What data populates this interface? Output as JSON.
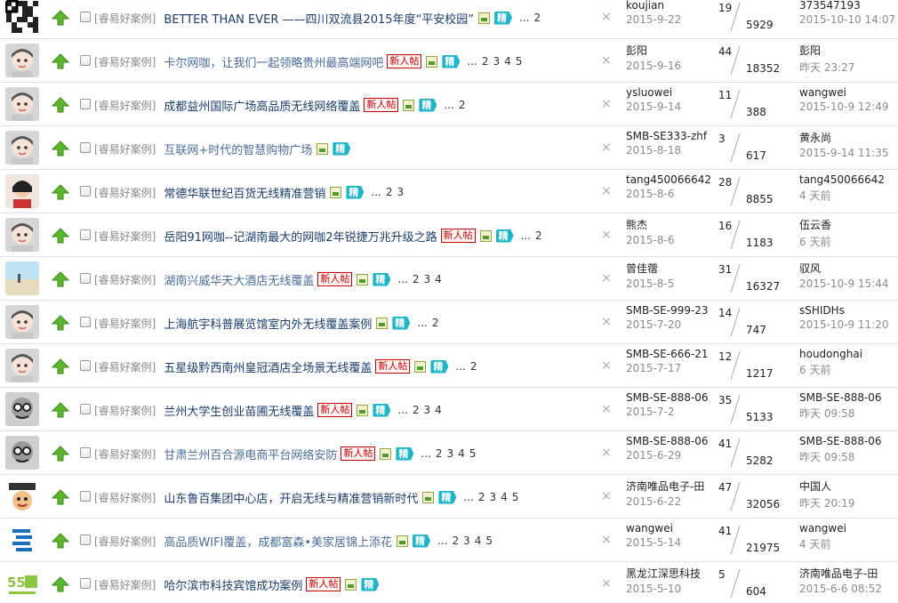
{
  "threads": [
    {
      "avatar": "qr",
      "tag": "[睿易好案例]",
      "title": "BETTER THAN EVER ——四川双流县2015年度“平安校园”",
      "dim": false,
      "new": false,
      "img": true,
      "jing": true,
      "pages": [
        "...",
        "2"
      ],
      "author": "koujian",
      "date": "2015-9-22",
      "replies": "19",
      "views": "5929",
      "last_user": "373547193",
      "last_time": "2015-10-10 14:07"
    },
    {
      "avatar": "face",
      "tag": "[睿易好案例]",
      "title": "卡尔网咖，让我们一起领略贵州最高端网吧",
      "dim": true,
      "new": true,
      "img": true,
      "jing": true,
      "pages": [
        "...",
        "2",
        "3",
        "4",
        "5"
      ],
      "author": "彭阳",
      "date": "2015-9-16",
      "replies": "44",
      "views": "18352",
      "last_user": "彭阳",
      "last_time": "昨天 23:27"
    },
    {
      "avatar": "face",
      "tag": "[睿易好案例]",
      "title": "成都益州国际广场高品质无线网络覆盖",
      "dim": false,
      "new": true,
      "img": true,
      "jing": true,
      "pages": [
        "...",
        "2"
      ],
      "author": "ysluowei",
      "date": "2015-9-14",
      "replies": "11",
      "views": "388",
      "last_user": "wangwei",
      "last_time": "2015-10-9 12:49"
    },
    {
      "avatar": "face",
      "tag": "[睿易好案例]",
      "title": "互联网+时代的智慧购物广场",
      "dim": true,
      "new": false,
      "img": true,
      "jing": true,
      "pages": [],
      "author": "SMB-SE333-zhf",
      "date": "2015-8-18",
      "replies": "3",
      "views": "617",
      "last_user": "黄永尚",
      "last_time": "2015-9-14 11:35"
    },
    {
      "avatar": "girl",
      "tag": "[睿易好案例]",
      "title": "常德华联世纪百货无线精准营销",
      "dim": false,
      "new": false,
      "img": true,
      "jing": true,
      "pages": [
        "...",
        "2",
        "3"
      ],
      "author": "tang450066642",
      "date": "2015-8-6",
      "replies": "28",
      "views": "8855",
      "last_user": "tang450066642",
      "last_time": "4 天前"
    },
    {
      "avatar": "face",
      "tag": "[睿易好案例]",
      "title": "岳阳91网咖--记湖南最大的网咖2年锐捷万兆升级之路",
      "dim": false,
      "new": true,
      "img": true,
      "jing": true,
      "pages": [
        "...",
        "2"
      ],
      "author": "熊杰",
      "date": "2015-8-6",
      "replies": "16",
      "views": "1183",
      "last_user": "伍云香",
      "last_time": "6 天前"
    },
    {
      "avatar": "beach",
      "tag": "[睿易好案例]",
      "title": "湖南兴威华天大酒店无线覆盖",
      "dim": true,
      "new": true,
      "img": true,
      "jing": true,
      "pages": [
        "...",
        "2",
        "3",
        "4"
      ],
      "author": "曾佳蓿",
      "date": "2015-8-5",
      "replies": "31",
      "views": "16327",
      "last_user": "驭风",
      "last_time": "2015-10-9 15:44"
    },
    {
      "avatar": "face",
      "tag": "[睿易好案例]",
      "title": "上海航宇科普展览馆室内外无线覆盖案例",
      "dim": false,
      "new": false,
      "img": true,
      "jing": true,
      "pages": [
        "...",
        "2"
      ],
      "author": "SMB-SE-999-23",
      "date": "2015-7-20",
      "replies": "14",
      "views": "747",
      "last_user": "sSHIDHs",
      "last_time": "2015-10-9 11:20"
    },
    {
      "avatar": "face",
      "tag": "[睿易好案例]",
      "title": "五星级黔西南州皇冠酒店全场景无线覆盖",
      "dim": false,
      "new": true,
      "img": true,
      "jing": true,
      "pages": [
        "...",
        "2"
      ],
      "author": "SMB-SE-666-21",
      "date": "2015-7-17",
      "replies": "12",
      "views": "1217",
      "last_user": "houdonghai",
      "last_time": "6 天前"
    },
    {
      "avatar": "bw",
      "tag": "[睿易好案例]",
      "title": "兰州大学生创业苗圃无线覆盖",
      "dim": false,
      "new": true,
      "img": true,
      "jing": true,
      "pages": [
        "...",
        "2",
        "3",
        "4"
      ],
      "author": "SMB-SE-888-06",
      "date": "2015-7-2",
      "replies": "35",
      "views": "5133",
      "last_user": "SMB-SE-888-06",
      "last_time": "昨天 09:58"
    },
    {
      "avatar": "bw",
      "tag": "[睿易好案例]",
      "title": "甘肃兰州百合源电商平台网络安防",
      "dim": true,
      "new": true,
      "img": true,
      "jing": true,
      "pages": [
        "...",
        "2",
        "3",
        "4",
        "5"
      ],
      "author": "SMB-SE-888-06",
      "date": "2015-6-29",
      "replies": "41",
      "views": "5282",
      "last_user": "SMB-SE-888-06",
      "last_time": "昨天 09:58"
    },
    {
      "avatar": "cartoon",
      "tag": "[睿易好案例]",
      "title": "山东鲁百集团中心店，开启无线与精准营销新时代",
      "dim": false,
      "new": false,
      "img": true,
      "jing": true,
      "pages": [
        "...",
        "2",
        "3",
        "4",
        "5"
      ],
      "author": "济南唯品电子-田",
      "date": "2015-6-22",
      "replies": "47",
      "views": "32056",
      "last_user": "中国人",
      "last_time": "昨天 20:19"
    },
    {
      "avatar": "logo3",
      "tag": "[睿易好案例]",
      "title": "高品质WIFI覆盖，成都富森•美家居锦上添花",
      "dim": true,
      "new": false,
      "img": true,
      "jing": true,
      "pages": [
        "...",
        "2",
        "3",
        "4",
        "5"
      ],
      "author": "wangwei",
      "date": "2015-5-14",
      "replies": "41",
      "views": "21975",
      "last_user": "wangwei",
      "last_time": "4 天前"
    },
    {
      "avatar": "logo55",
      "tag": "[睿易好案例]",
      "title": "哈尔滨市科技宾馆成功案例",
      "dim": false,
      "new": true,
      "img": true,
      "jing": true,
      "pages": [],
      "author": "黑龙江深思科技",
      "date": "2015-5-10",
      "replies": "5",
      "views": "604",
      "last_user": "济南唯品电子-田",
      "last_time": "2015-6-6 08:52"
    }
  ],
  "labels": {
    "new_badge": "新人帖",
    "jing_badge": "精",
    "close_glyph": "×"
  }
}
